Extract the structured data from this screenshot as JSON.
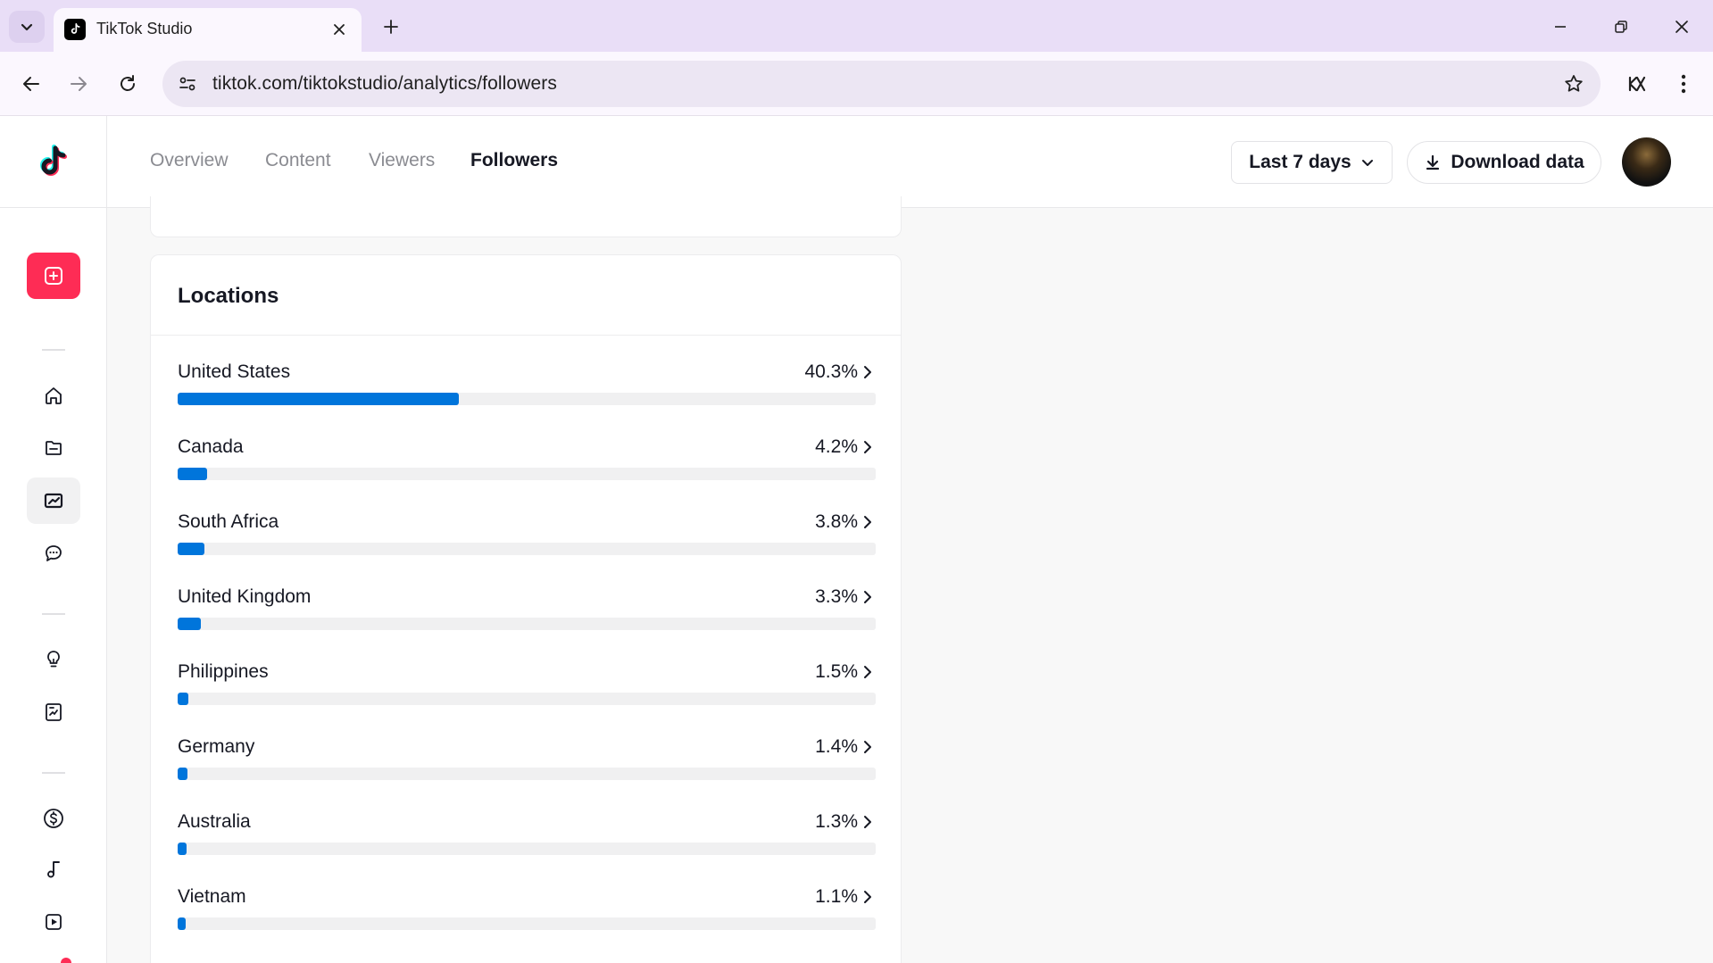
{
  "browser": {
    "tab_title": "TikTok Studio",
    "url": "tiktok.com/tiktokstudio/analytics/followers"
  },
  "header": {
    "tabs": [
      {
        "label": "Overview"
      },
      {
        "label": "Content"
      },
      {
        "label": "Viewers"
      },
      {
        "label": "Followers"
      }
    ],
    "active_tab": "Followers",
    "date_range": "Last 7 days",
    "download_label": "Download data"
  },
  "sidebar": {
    "items": [
      {
        "icon": "home-icon"
      },
      {
        "icon": "content-folder-icon"
      },
      {
        "icon": "analytics-icon",
        "active": true
      },
      {
        "icon": "comments-icon"
      },
      {
        "icon": "lightbulb-icon"
      },
      {
        "icon": "academy-icon"
      },
      {
        "icon": "dollar-icon"
      },
      {
        "icon": "music-icon"
      },
      {
        "icon": "play-icon"
      }
    ]
  },
  "locations": {
    "title": "Locations",
    "rows": [
      {
        "name": "United States",
        "pct_label": "40.3%",
        "pct": 40.3
      },
      {
        "name": "Canada",
        "pct_label": "4.2%",
        "pct": 4.2
      },
      {
        "name": "South Africa",
        "pct_label": "3.8%",
        "pct": 3.8
      },
      {
        "name": "United Kingdom",
        "pct_label": "3.3%",
        "pct": 3.3
      },
      {
        "name": "Philippines",
        "pct_label": "1.5%",
        "pct": 1.5
      },
      {
        "name": "Germany",
        "pct_label": "1.4%",
        "pct": 1.4
      },
      {
        "name": "Australia",
        "pct_label": "1.3%",
        "pct": 1.3
      },
      {
        "name": "Vietnam",
        "pct_label": "1.1%",
        "pct": 1.1
      }
    ]
  },
  "colors": {
    "accent": "#fe2c55",
    "bar_fill": "#0075db",
    "bar_track": "#f0f0f1",
    "browser_frame": "#e9def7"
  }
}
